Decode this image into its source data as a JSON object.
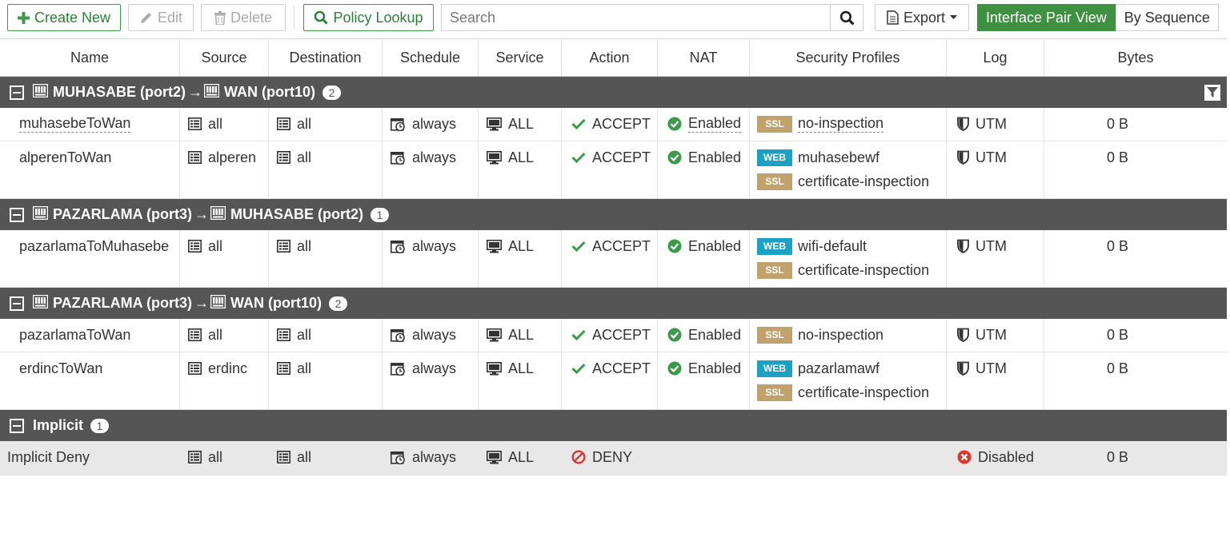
{
  "toolbar": {
    "create_new": "Create New",
    "edit": "Edit",
    "delete": "Delete",
    "policy_lookup": "Policy Lookup",
    "search_placeholder": "Search",
    "export": "Export",
    "interface_pair_view": "Interface Pair View",
    "by_sequence": "By Sequence"
  },
  "columns": [
    "Name",
    "Source",
    "Destination",
    "Schedule",
    "Service",
    "Action",
    "NAT",
    "Security Profiles",
    "Log",
    "Bytes"
  ],
  "groups": [
    {
      "source_iface": "MUHASABE (port2)",
      "dest_iface": "WAN (port10)",
      "arrow": "→",
      "count": "2",
      "rows": [
        {
          "name": "muhasebeToWan",
          "source": "all",
          "destination": "all",
          "schedule": "always",
          "service": "ALL",
          "action": "ACCEPT",
          "nat": "Enabled",
          "profiles": [
            {
              "type": "SSL",
              "name": "no-inspection"
            }
          ],
          "log": "UTM",
          "bytes": "0 B"
        },
        {
          "name": "alperenToWan",
          "source": "alperen",
          "destination": "all",
          "schedule": "always",
          "service": "ALL",
          "action": "ACCEPT",
          "nat": "Enabled",
          "profiles": [
            {
              "type": "WEB",
              "name": "muhasebewf"
            },
            {
              "type": "SSL",
              "name": "certificate-inspection"
            }
          ],
          "log": "UTM",
          "bytes": "0 B"
        }
      ]
    },
    {
      "source_iface": "PAZARLAMA (port3)",
      "dest_iface": "MUHASABE (port2)",
      "arrow": "→",
      "count": "1",
      "rows": [
        {
          "name": "pazarlamaToMuhasebe",
          "source": "all",
          "destination": "all",
          "schedule": "always",
          "service": "ALL",
          "action": "ACCEPT",
          "nat": "Enabled",
          "profiles": [
            {
              "type": "WEB",
              "name": "wifi-default"
            },
            {
              "type": "SSL",
              "name": "certificate-inspection"
            }
          ],
          "log": "UTM",
          "bytes": "0 B"
        }
      ]
    },
    {
      "source_iface": "PAZARLAMA (port3)",
      "dest_iface": "WAN (port10)",
      "arrow": "→",
      "count": "2",
      "rows": [
        {
          "name": "pazarlamaToWan",
          "source": "all",
          "destination": "all",
          "schedule": "always",
          "service": "ALL",
          "action": "ACCEPT",
          "nat": "Enabled",
          "profiles": [
            {
              "type": "SSL",
              "name": "no-inspection"
            }
          ],
          "log": "UTM",
          "bytes": "0 B"
        },
        {
          "name": "erdincToWan",
          "source": "erdinc",
          "destination": "all",
          "schedule": "always",
          "service": "ALL",
          "action": "ACCEPT",
          "nat": "Enabled",
          "profiles": [
            {
              "type": "WEB",
              "name": "pazarlamawf"
            },
            {
              "type": "SSL",
              "name": "certificate-inspection"
            }
          ],
          "log": "UTM",
          "bytes": "0 B"
        }
      ]
    }
  ],
  "implicit": {
    "label": "Implicit",
    "count": "1",
    "row": {
      "name": "Implicit Deny",
      "source": "all",
      "destination": "all",
      "schedule": "always",
      "service": "ALL",
      "action": "DENY",
      "log": "Disabled",
      "bytes": "0 B"
    }
  },
  "colors": {
    "accent_green": "#3f9142",
    "group_header": "#555555",
    "accept_green": "#3a9a4a",
    "deny_red": "#e0352b",
    "web_badge": "#1aa1c4",
    "ssl_badge": "#c1a26d"
  },
  "icons": [
    "plus-icon",
    "pencil-icon",
    "trash-icon",
    "search-icon",
    "document-icon",
    "caret-down-icon",
    "interface-icon",
    "address-icon",
    "schedule-icon",
    "service-icon",
    "check-icon",
    "check-circle-icon",
    "shield-icon",
    "deny-icon",
    "disabled-icon",
    "filter-icon",
    "collapse-icon"
  ]
}
